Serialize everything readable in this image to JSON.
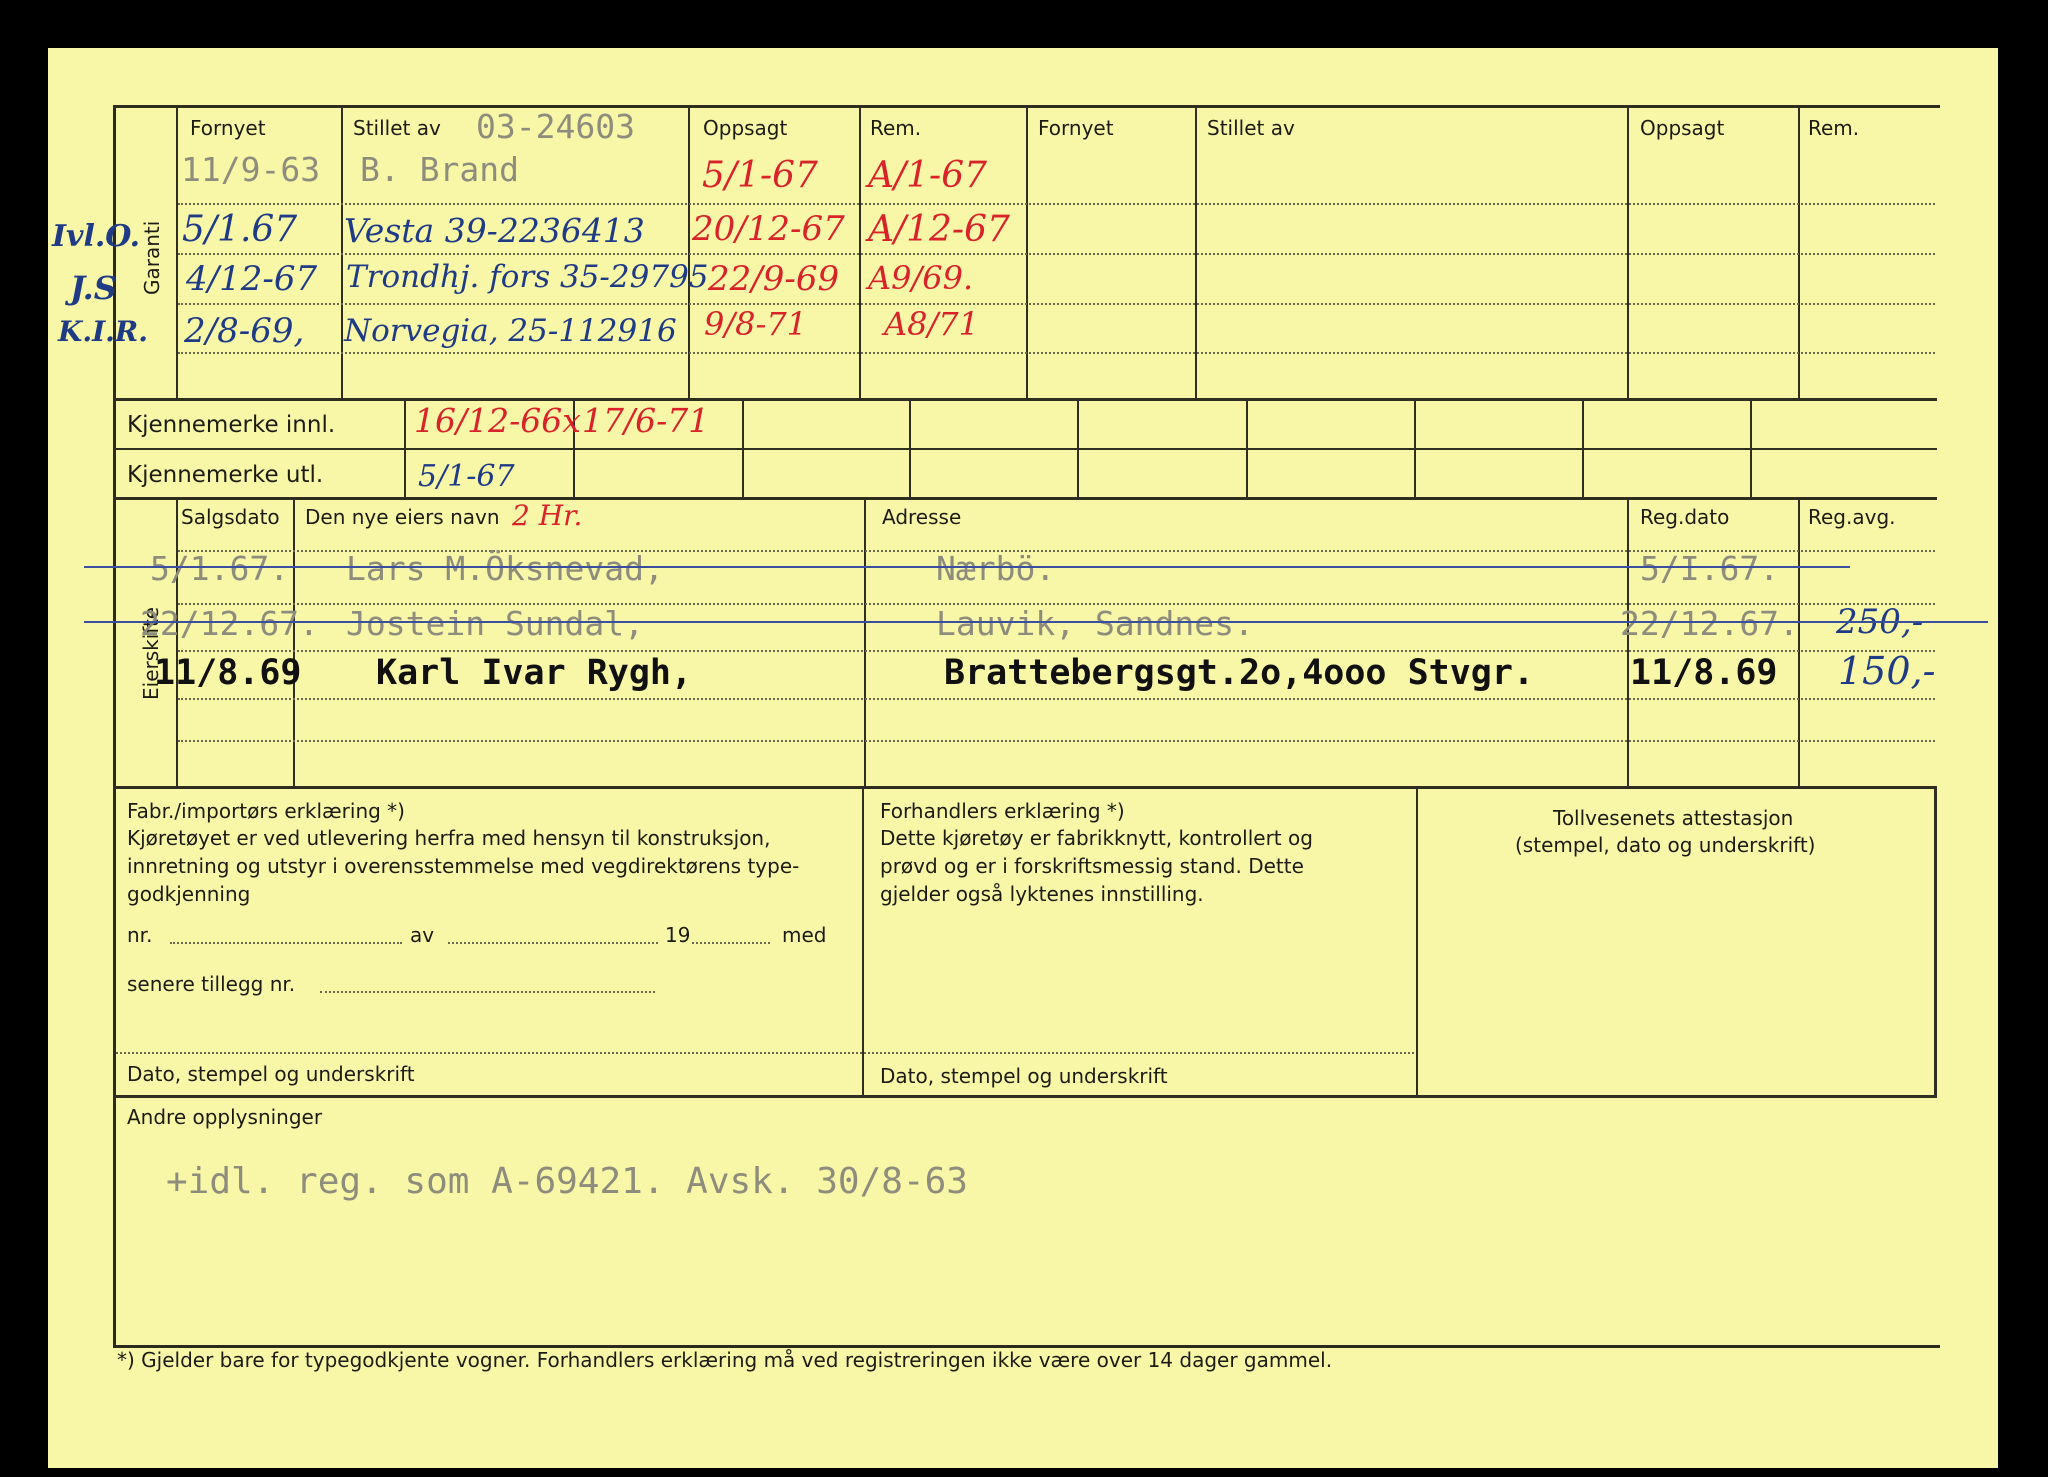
{
  "section1": {
    "headers": {
      "fornyet": "Fornyet",
      "stillet_av": "Stillet av",
      "oppsagt": "Oppsagt",
      "rem": "Rem.",
      "fornyet2": "Fornyet",
      "stillet_av2": "Stillet av",
      "oppsagt2": "Oppsagt",
      "rem2": "Rem."
    },
    "side_label": "Garanti",
    "policy_number": "03-24603",
    "row1": {
      "fornyet": "11/9-63",
      "stillet_av": "B. Brand",
      "oppsagt": "5/1-67",
      "rem": "A/1-67"
    },
    "row2": {
      "fornyet": "5/1.67",
      "stillet_av": "Vesta 39-2236413",
      "oppsagt": "20/12-67",
      "rem": "A/12-67"
    },
    "row3": {
      "fornyet": "4/12-67",
      "stillet_av": "Trondhj. fors 35-29795",
      "oppsagt": "22/9-69",
      "rem": "A9/69."
    },
    "row4": {
      "fornyet": "2/8-69,",
      "stillet_av": "Norvegia, 25-112916",
      "oppsagt": "9/8-71",
      "rem": "A8/71"
    },
    "margin_notes": [
      "Ivl.O.",
      "J.S",
      "K.I.R."
    ]
  },
  "kjennemerke": {
    "innl_label": "Kjennemerke innl.",
    "utl_label": "Kjennemerke utl.",
    "innl_values": [
      "16/12-66x",
      "17/6-71"
    ],
    "utl_values": [
      "5/1-67"
    ]
  },
  "eierskifte": {
    "side_label": "Eierskifte",
    "headers": {
      "salgsdato": "Salgsdato",
      "navn": "Den nye eiers navn",
      "navn_note": "2 Hr.",
      "adresse": "Adresse",
      "regdato": "Reg.dato",
      "regavg": "Reg.avg."
    },
    "rows": [
      {
        "salgsdato": "5/1.67.",
        "navn": "Lars M.Öksnevad,",
        "adresse": "Nærbö.",
        "regdato": "5/I.67.",
        "regavg": "",
        "struck": true
      },
      {
        "salgsdato": "22/12.67.",
        "navn": "Jostein Sundal,",
        "adresse": "Lauvik, Sandnes.",
        "regdato": "22/12.67.",
        "regavg": "250,-",
        "struck": true
      },
      {
        "salgsdato": "11/8.69",
        "navn": "Karl Ivar Rygh,",
        "adresse": "Brattebergsgt.2o,4ooo Stvgr.",
        "regdato": "11/8.69",
        "regavg": "150,-",
        "struck": false
      }
    ]
  },
  "erklaering": {
    "fabr_title": "Fabr./importørs erklæring *)",
    "fabr_text": "Kjøretøyet er ved utlevering herfra med hensyn til konstruksjon, innretning og utstyr i overensstemmelse med vegdirektørens type-godkjenning",
    "fabr_nr": "nr.",
    "fabr_av": "av",
    "fabr_19": "19",
    "fabr_med": "med",
    "fabr_tillegg": "senere tillegg nr.",
    "fabr_sign": "Dato, stempel og underskrift",
    "forh_title": "Forhandlers erklæring *)",
    "forh_text": "Dette kjøretøy er fabrikknytt, kontrollert og prøvd og er i forskriftsmessig stand. Dette gjelder også lyktenes innstilling.",
    "forh_sign": "Dato, stempel og underskrift",
    "toll_title": "Tollvesenets attestasjon",
    "toll_sub": "(stempel, dato og underskrift)"
  },
  "andre": {
    "label": "Andre opplysninger",
    "text": "+idl. reg. som A-69421. Avsk. 30/8-63"
  },
  "footnote": "*)  Gjelder bare for typegodkjente vogner.  Forhandlers erklæring må ved registreringen ikke være over 14 dager gammel."
}
